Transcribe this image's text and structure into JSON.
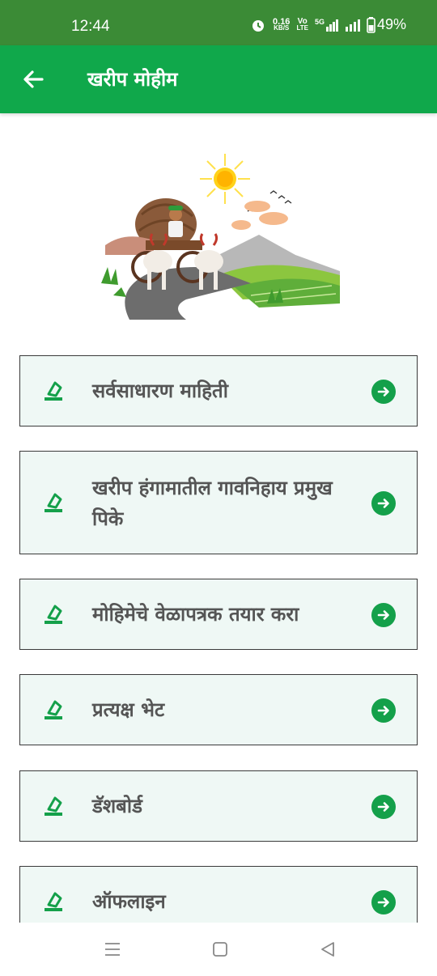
{
  "status_bar": {
    "time": "12:44",
    "speed_value": "0.16",
    "speed_unit": "KB/S",
    "volte_top": "Vo",
    "volte_bottom": "LTE",
    "network": "5G",
    "battery": "49%"
  },
  "app_bar": {
    "title": "खरीप मोहीम",
    "back_icon": "arrow-left-icon"
  },
  "hero_image": {
    "subject": "farmer-bullock-cart-illustration"
  },
  "menu": {
    "items": [
      {
        "label": "सर्वसाधारण माहिती"
      },
      {
        "label": "खरीप हंगामातील गावनिहाय प्रमुख पिके"
      },
      {
        "label": "मोहिमेचे वेळापत्रक तयार करा"
      },
      {
        "label": "प्रत्यक्ष भेट"
      },
      {
        "label": "डॅशबोर्ड"
      },
      {
        "label": "ऑफलाइन"
      }
    ],
    "item_icon": "edit-document-icon",
    "arrow_icon": "arrow-right-circle-icon"
  },
  "nav_bar": {
    "recents_icon": "menu-lines-icon",
    "home_icon": "square-home-icon",
    "back_icon": "triangle-back-icon"
  },
  "colors": {
    "status_bar": "#3b8b36",
    "app_bar": "#10a84b",
    "accent_green": "#14a04a",
    "card_background": "#eff8f5",
    "card_border": "#3a3a3a",
    "label_text": "#555555"
  }
}
